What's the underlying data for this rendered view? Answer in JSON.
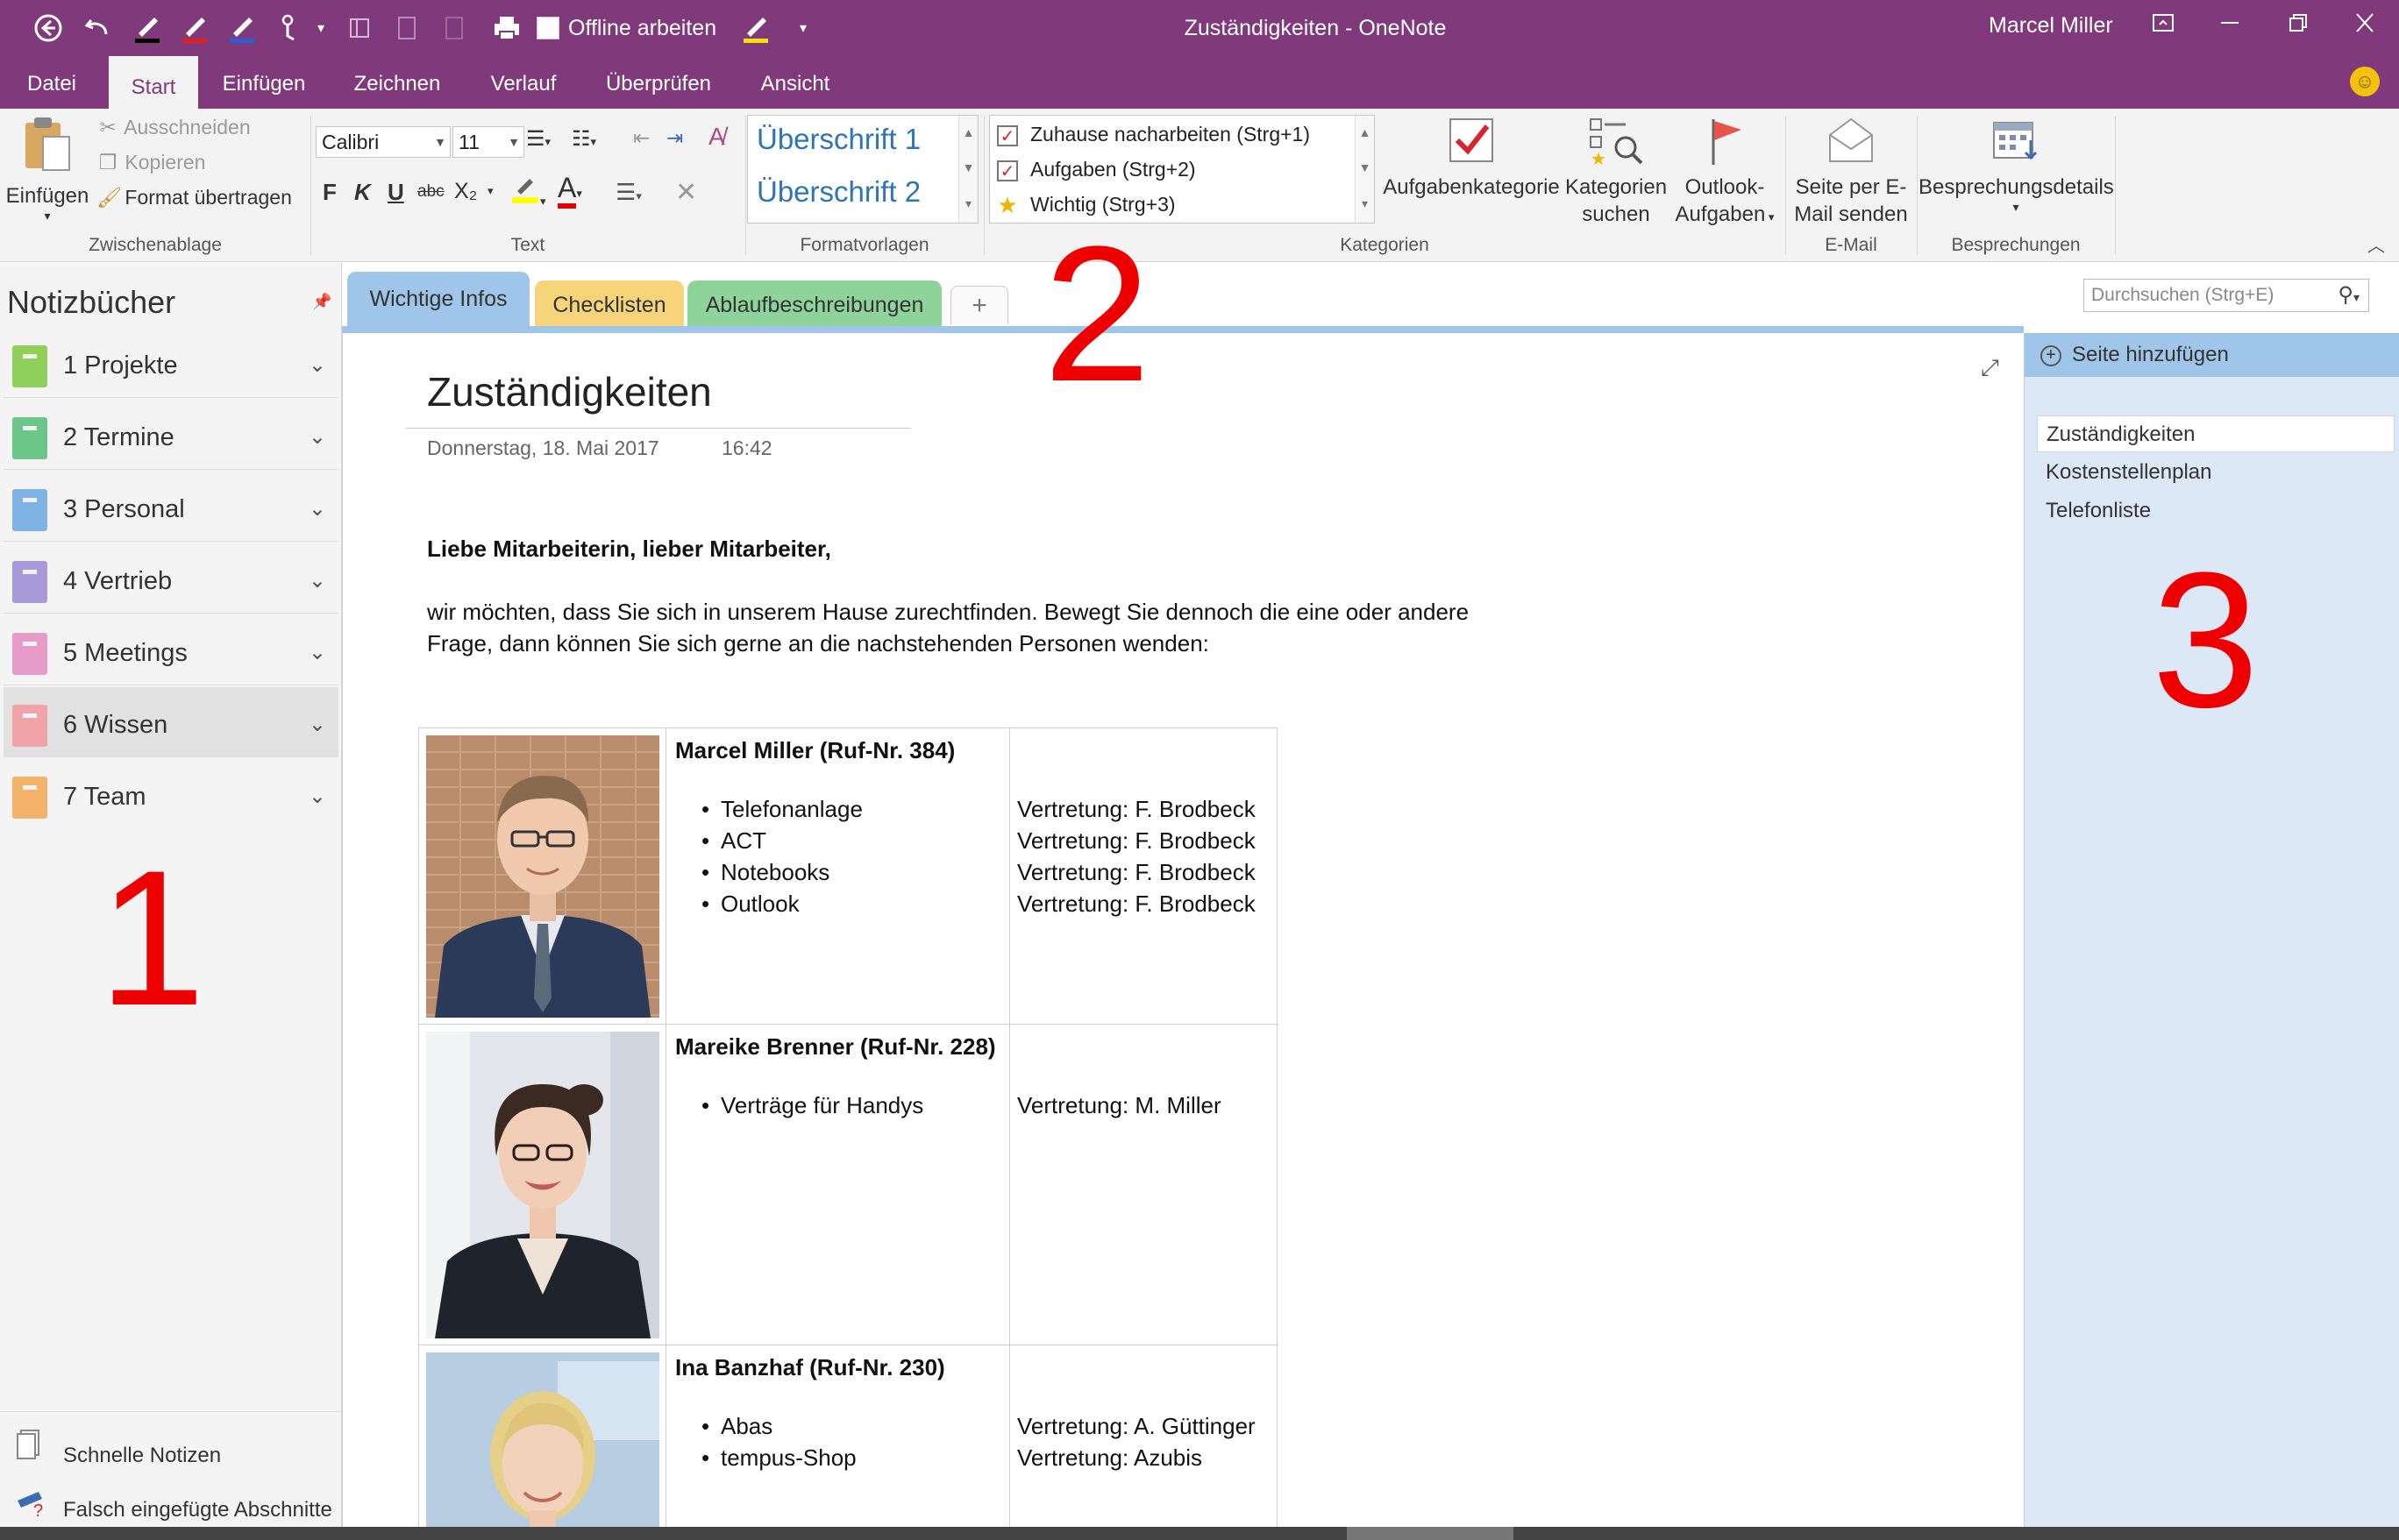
{
  "titlebar": {
    "title": "Zuständigkeiten  -  OneNote",
    "offline_label": "Offline arbeiten",
    "user": "Marcel Miller"
  },
  "ribbon_tabs": [
    "Datei",
    "Start",
    "Einfügen",
    "Zeichnen",
    "Verlauf",
    "Überprüfen",
    "Ansicht"
  ],
  "ribbon": {
    "clipboard": {
      "paste": "Einfügen",
      "cut": "Ausschneiden",
      "copy": "Kopieren",
      "format_painter": "Format übertragen",
      "group": "Zwischenablage"
    },
    "text": {
      "font": "Calibri",
      "size": "11",
      "bold": "F",
      "italic": "K",
      "underline": "U",
      "strike": "abc",
      "subscript": "X₂",
      "font_color": "A",
      "group": "Text"
    },
    "styles": {
      "h1": "Überschrift 1",
      "h2": "Überschrift 2",
      "group": "Formatvorlagen"
    },
    "tags": {
      "items": [
        "Zuhause nacharbeiten (Strg+1)",
        "Aufgaben (Strg+2)",
        "Wichtig (Strg+3)"
      ],
      "task_category": "Aufgabenkategorie",
      "find_tags_1": "Kategorien",
      "find_tags_2": "suchen",
      "outlook_1": "Outlook-",
      "outlook_2": "Aufgaben",
      "group": "Kategorien"
    },
    "email": {
      "line1": "Seite per E-",
      "line2": "Mail senden",
      "group": "E-Mail"
    },
    "meetings": {
      "details": "Besprechungsdetails",
      "group": "Besprechungen"
    }
  },
  "notebooks": {
    "header": "Notizbücher",
    "items": [
      {
        "label": "1 Projekte",
        "color": "#8fcf5a"
      },
      {
        "label": "2 Termine",
        "color": "#6cc68a"
      },
      {
        "label": "3 Personal",
        "color": "#7fb2e5"
      },
      {
        "label": "4 Vertrieb",
        "color": "#a89ad8"
      },
      {
        "label": "5 Meetings",
        "color": "#e79bc9"
      },
      {
        "label": "6 Wissen",
        "color": "#f0a4a8"
      },
      {
        "label": "7 Team",
        "color": "#f2b26a"
      }
    ],
    "quick_notes": "Schnelle Notizen",
    "misplaced": "Falsch eingefügte Abschnitte"
  },
  "sections": [
    {
      "label": "Wichtige Infos",
      "color": "#9fc5e8"
    },
    {
      "label": "Checklisten",
      "color": "#f6d47a"
    },
    {
      "label": "Ablaufbeschreibungen",
      "color": "#8ed49a"
    }
  ],
  "search": {
    "placeholder": "Durchsuchen (Strg+E)"
  },
  "page": {
    "title": "Zuständigkeiten",
    "date": "Donnerstag, 18. Mai 2017",
    "time": "16:42",
    "greeting": "Liebe Mitarbeiterin, lieber Mitarbeiter,",
    "intro_1": "wir möchten, dass Sie sich in unserem Hause zurechtfinden. Bewegt Sie dennoch die eine oder andere",
    "intro_2": "Frage, dann können Sie sich gerne an die nachstehenden Personen wenden:",
    "people": [
      {
        "name": "Marcel Miller (Ruf-Nr. 384)",
        "duties": [
          "Telefonanlage",
          "ACT",
          "Notebooks",
          "Outlook"
        ],
        "reps": [
          "Vertretung: F. Brodbeck",
          "Vertretung: F. Brodbeck",
          "Vertretung: F. Brodbeck",
          "Vertretung: F. Brodbeck"
        ]
      },
      {
        "name": "Mareike Brenner (Ruf-Nr. 228)",
        "duties": [
          "Verträge für Handys"
        ],
        "reps": [
          "Vertretung: M. Miller"
        ]
      },
      {
        "name": "Ina Banzhaf (Ruf-Nr. 230)",
        "duties": [
          "Abas",
          "tempus-Shop"
        ],
        "reps": [
          "Vertretung: A. Güttinger",
          "Vertretung: Azubis"
        ]
      }
    ]
  },
  "pages": {
    "add": "Seite hinzufügen",
    "items": [
      "Zuständigkeiten",
      "Kostenstellenplan",
      "Telefonliste"
    ]
  },
  "annotations": [
    "1",
    "2",
    "3"
  ]
}
